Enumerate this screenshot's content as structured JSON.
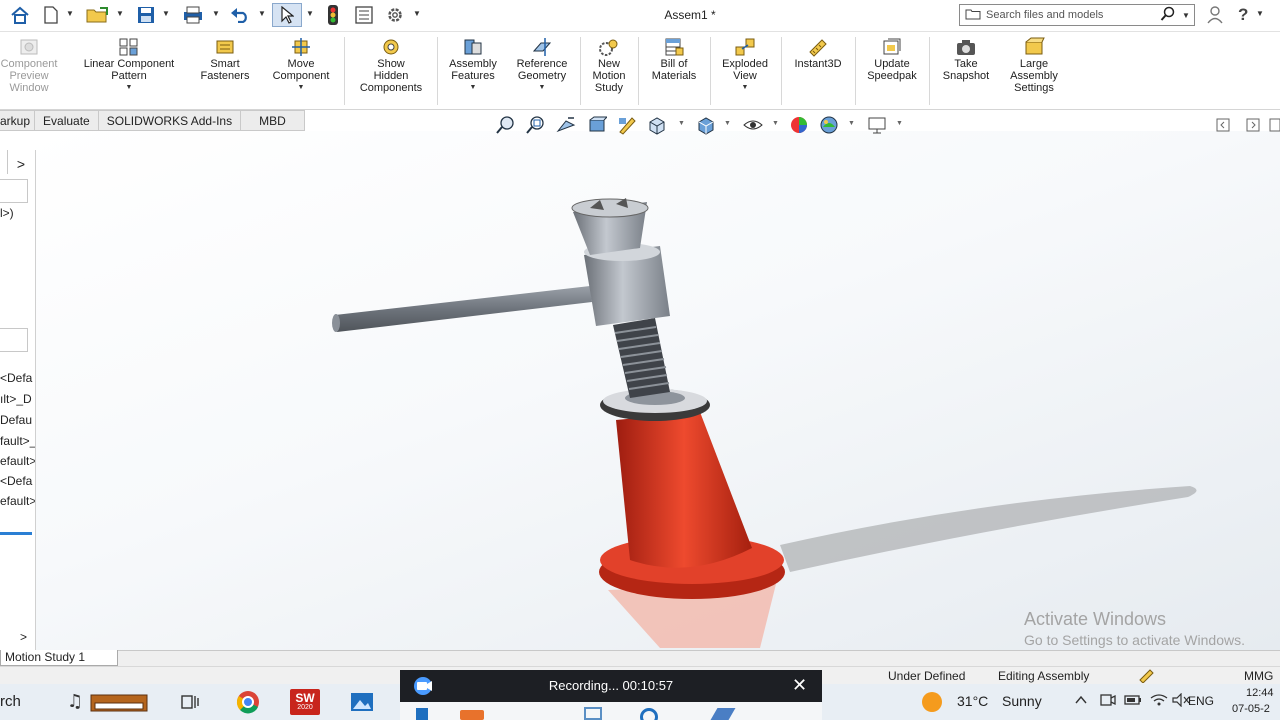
{
  "window": {
    "title": "Assem1 *"
  },
  "titlebar": {
    "search_placeholder": "Search files and models",
    "quick_access": [
      "home-icon",
      "new-document-icon",
      "open-folder-icon",
      "save-icon",
      "print-icon",
      "undo-icon",
      "select-pointer-icon",
      "traffic-light-icon",
      "file-properties-icon",
      "gear-icon"
    ],
    "help_label": "?"
  },
  "commands": {
    "component_preview": "Component\nPreview\nWindow",
    "linear_pattern": "Linear Component\nPattern",
    "smart_fasteners": "Smart\nFasteners",
    "move_component": "Move\nComponent",
    "show_hidden": "Show\nHidden\nComponents",
    "assembly_features": "Assembly\nFeatures",
    "reference_geometry": "Reference\nGeometry",
    "new_motion_study": "New\nMotion\nStudy",
    "bill_of_materials": "Bill of\nMaterials",
    "exploded_view": "Exploded\nView",
    "instant3d": "Instant3D",
    "update_speedpak": "Update\nSpeedpak",
    "take_snapshot": "Take\nSnapshot",
    "large_assembly": "Large\nAssembly\nSettings"
  },
  "tabs": [
    "arkup",
    "Evaluate",
    "SOLIDWORKS Add-Ins",
    "MBD"
  ],
  "left_panel": {
    "arrow": ">",
    "config_text": "l>)",
    "tree_items": [
      "<Defa",
      "ılt>_D",
      "Defau",
      "fault>_",
      "efault>",
      "<Defa",
      "efault>"
    ],
    "scroll_arrow": ">"
  },
  "viewport": {
    "activate_title": "Activate Windows",
    "activate_sub": "Go to Settings to activate Windows."
  },
  "motion_study": {
    "tab_label": "Motion Study 1"
  },
  "status": {
    "under_defined": "Under Defined",
    "editing": "Editing Assembly",
    "units": "MMG"
  },
  "recording": {
    "text": "Recording... 00:10:57",
    "close": "✕"
  },
  "taskbar": {
    "search_text": "rch",
    "sw_badge": "SW",
    "sw_year": "2020",
    "weather_temp": "31°C",
    "weather_desc": "Sunny",
    "language": "ENG",
    "time": "12:44",
    "date": "07-05-2"
  },
  "colors": {
    "accent_blue": "#1f5fa8",
    "part_red": "#d8321f",
    "part_steel": "#8e949c"
  }
}
